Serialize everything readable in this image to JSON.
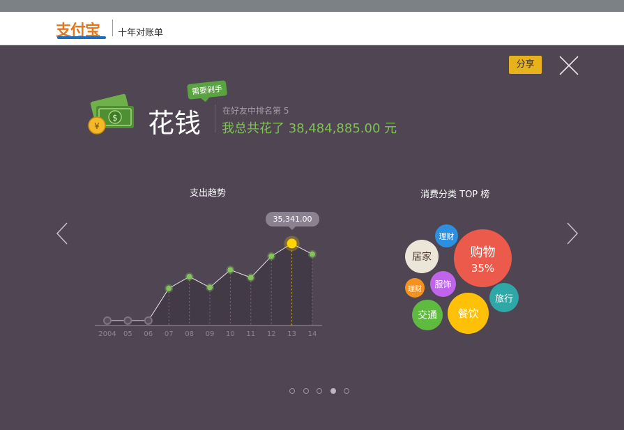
{
  "header": {
    "logo_text": "支付宝",
    "subtitle": "十年对账单"
  },
  "actions": {
    "share_label": "分享"
  },
  "hero": {
    "title": "花钱",
    "badge": "需要剁手",
    "rank": "在好友中排名第 5",
    "total": "我总共花了 38,484,885.00 元"
  },
  "trend": {
    "title": "支出趋势",
    "tooltip": "35,341.00"
  },
  "chart_data": {
    "type": "line",
    "title": "支出趋势",
    "categories": [
      "2004",
      "05",
      "06",
      "07",
      "08",
      "09",
      "10",
      "11",
      "12",
      "13",
      "14"
    ],
    "values": [
      0,
      0,
      0,
      0.33,
      0.45,
      0.34,
      0.52,
      0.44,
      0.66,
      0.79,
      0.68
    ],
    "highlight_index": 9,
    "highlight_label": "35,341.00",
    "colors": {
      "point": "#86c25a",
      "highlight": "#ffd400",
      "line": "#e8e4ea",
      "area": "#433a48"
    }
  },
  "categories": {
    "title": "消费分类 TOP 榜",
    "bubbles": [
      {
        "label": "购物",
        "value": "35%",
        "color": "#ec5a4c"
      },
      {
        "label": "居家",
        "color": "#ece6d8"
      },
      {
        "label": "理财",
        "color": "#2d8fe0"
      },
      {
        "label": "服饰",
        "color": "#c164ec"
      },
      {
        "label": "理财",
        "color": "#f5921e"
      },
      {
        "label": "交通",
        "color": "#5ebb3f"
      },
      {
        "label": "餐饮",
        "color": "#ffc107"
      },
      {
        "label": "旅行",
        "color": "#2fa7a6"
      }
    ]
  },
  "pagination": {
    "total": 5,
    "current": 4
  }
}
